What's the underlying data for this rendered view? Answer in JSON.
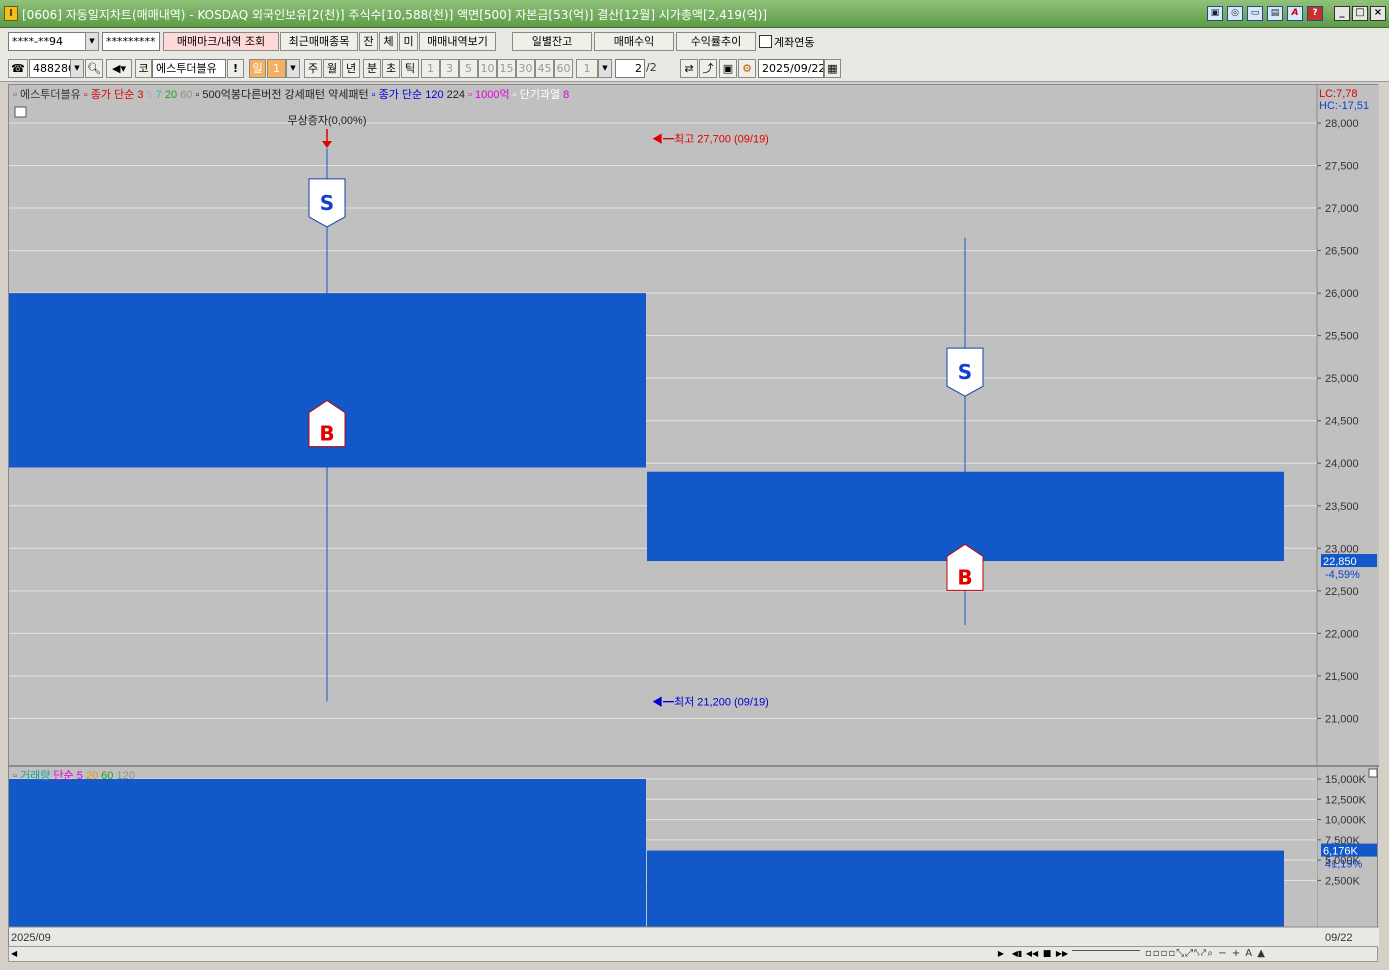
{
  "window": {
    "title": "[0606] 자동일지차트(매매내역) - KOSDAQ 외국인보유[2(천)] 주식수[10,588(천)] 액면[500] 자본금[53(억)] 결산[12월] 시가총액[2,419(억)]",
    "icon_label": "I",
    "title_icons": [
      "window-link-icon",
      "layers-icon",
      "copy-icon",
      "save-icon",
      "font-a-icon",
      "help-icon"
    ],
    "minimize": "_",
    "maximize": "□",
    "close": "×"
  },
  "toolbar1": {
    "account_value": "****-**94",
    "password_value": "*********",
    "trade_mark_btn": "매매마크/내역 조회",
    "recent_stocks_btn": "최근매매종목",
    "small_btns": [
      "잔",
      "체",
      "미"
    ],
    "view_history_btn": "매매내역보기",
    "daily_balance_btn": "일별잔고",
    "trade_profit_btn": "매매수익",
    "return_trend_btn": "수익률추이",
    "account_link_label": "계좌연동",
    "account_link_checked": false
  },
  "toolbar2": {
    "code_value": "488280",
    "code_btn": "코",
    "stock_name": "에스투더블유",
    "alert_btn": "!",
    "period_active": "일",
    "period_num": "1",
    "periods": [
      "주",
      "월",
      "년",
      "분",
      "초",
      "틱"
    ],
    "intervals": [
      "1",
      "3",
      "5",
      "10",
      "15",
      "30",
      "45",
      "60"
    ],
    "interval_select": "1",
    "page_value": "2",
    "page_total": "/2",
    "date_value": "2025/09/22"
  },
  "price_panel": {
    "legend": [
      {
        "text": "에스투더블유",
        "color": "#333333"
      },
      {
        "text": "종가 단순",
        "color": "#e00000"
      },
      {
        "text": "3",
        "color": "#e00000"
      },
      {
        "text": "5",
        "color": "#b0b0b0"
      },
      {
        "text": "7",
        "color": "#20c0c0"
      },
      {
        "text": "20",
        "color": "#20a020"
      },
      {
        "text": "60",
        "color": "#909090"
      },
      {
        "text": "500억봉다른버전 강세패턴",
        "color": "#222222"
      },
      {
        "text": "약세패턴",
        "color": "#222222"
      },
      {
        "text": "종가 단순",
        "color": "#0000e0"
      },
      {
        "text": "120",
        "color": "#0000e0"
      },
      {
        "text": "224",
        "color": "#222222"
      },
      {
        "text": "1000억",
        "color": "#e000e0"
      },
      {
        "text": "단기과열",
        "color": "#ffffff"
      },
      {
        "text": "8",
        "color": "#e000e0"
      }
    ],
    "lc": "LC:7,78",
    "hc": "HC:-17,51",
    "event_label": "무상증자(0,00%)",
    "high_label": "최고 27,700 (09/19)",
    "low_label": "최저 21,200 (09/19)",
    "y_ticks": [
      "28,000",
      "27,500",
      "27,000",
      "26,500",
      "26,000",
      "25,500",
      "25,000",
      "24,500",
      "24,000",
      "23,500",
      "23,000",
      "22,500",
      "22,000",
      "21,500",
      "21,000"
    ],
    "current_price": "22,850",
    "current_change": "-4,59%",
    "sell_mark": "S",
    "buy_mark": "B"
  },
  "volume_panel": {
    "legend": [
      {
        "text": "거래량",
        "color": "#20a0a0"
      },
      {
        "text": "단순",
        "color": "#e000e0"
      },
      {
        "text": "5",
        "color": "#e000e0"
      },
      {
        "text": "20",
        "color": "#e0a000"
      },
      {
        "text": "60",
        "color": "#20a020"
      },
      {
        "text": "120",
        "color": "#909090"
      }
    ],
    "y_ticks": [
      "15,000K",
      "12,500K",
      "10,000K",
      "7,500K",
      "5,000K",
      "2,500K"
    ],
    "current_volume": "6,176K",
    "current_change": "41,19%",
    "close_icon": "x"
  },
  "x_axis": {
    "left_label": "2025/09",
    "right_label": "09/22"
  },
  "chart_data": [
    {
      "type": "candlestick",
      "title": "에스투더블유",
      "categories": [
        "09/19",
        "09/22"
      ],
      "series": [
        {
          "name": "에스투더블유",
          "values": [
            {
              "date": "09/19",
              "open": 26000,
              "high": 27700,
              "low": 21200,
              "close": 23950
            },
            {
              "date": "09/22",
              "open": 23900,
              "high": 26650,
              "low": 22100,
              "close": 22850
            }
          ]
        }
      ],
      "trade_marks": [
        {
          "date": "09/19",
          "side": "S",
          "price": 26990
        },
        {
          "date": "09/19",
          "side": "B",
          "price": 24560
        },
        {
          "date": "09/22",
          "side": "S",
          "price": 25000
        },
        {
          "date": "09/22",
          "side": "B",
          "price": 22870
        }
      ],
      "ylim": [
        20500,
        28200
      ],
      "up_color": "#1258c8",
      "down_color": "#1258c8",
      "grid": true
    },
    {
      "type": "bar",
      "title": "거래량",
      "categories": [
        "09/19",
        "09/22"
      ],
      "values": [
        15000,
        6176
      ],
      "ylim": [
        0,
        16000
      ],
      "color": "#1258c8",
      "grid": true
    }
  ]
}
